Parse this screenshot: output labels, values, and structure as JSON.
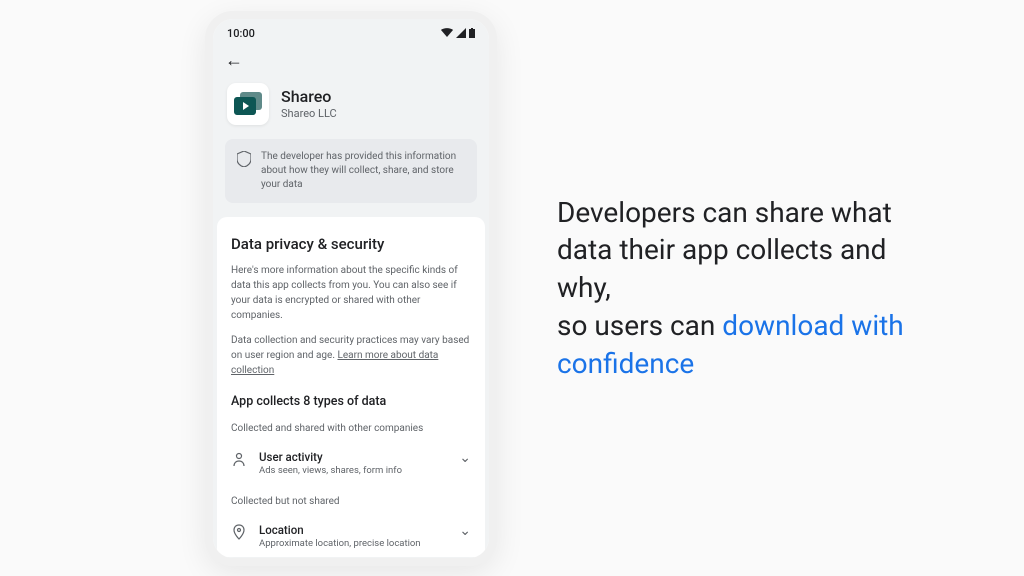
{
  "statusBar": {
    "time": "10:00"
  },
  "app": {
    "name": "Shareo",
    "developer": "Shareo LLC"
  },
  "infoBox": {
    "text": "The developer has provided this information about how they will collect, share, and store your data"
  },
  "privacy": {
    "title": "Data privacy & security",
    "body1": "Here's more information about the specific kinds of data this app collects from you. You can also see if your data is encrypted or shared with other companies.",
    "body2a": "Data collection and security practices may vary based on user region and age. ",
    "learnLink": "Learn more about data collection",
    "collectsTitle": "App collects 8 types of data",
    "sharedLabel": "Collected and shared with other companies",
    "notSharedLabel": "Collected but not shared",
    "rows": {
      "activity": {
        "title": "User activity",
        "sub": "Ads seen, views, shares, form info"
      },
      "location": {
        "title": "Location",
        "sub": "Approximate location, precise location"
      }
    }
  },
  "caption": {
    "line1": "Developers can share what data their app collects and why,",
    "line2a": "so users can ",
    "line2b": "download with confidence"
  }
}
